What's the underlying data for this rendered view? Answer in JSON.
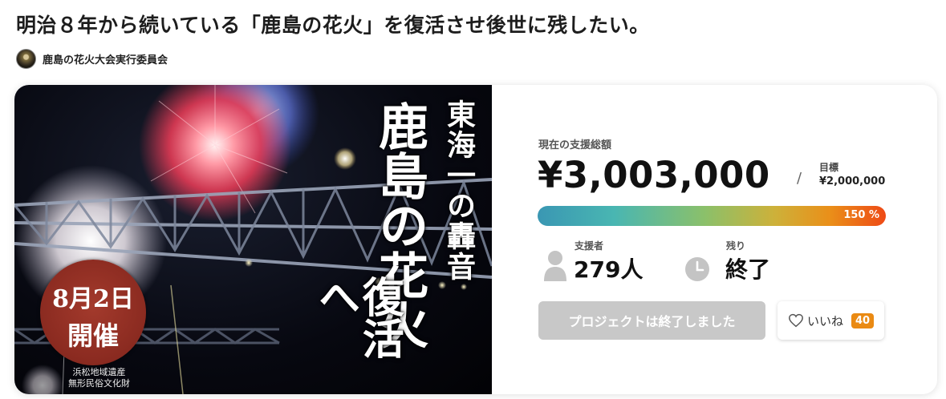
{
  "page": {
    "title": "明治８年から続いている「鹿島の花火」を復活させ後世に残したい。"
  },
  "owner": {
    "name": "鹿島の花火大会実行委員会"
  },
  "hero": {
    "catch_small": "東海一の轟音",
    "catch_big_1": "鹿島の花火",
    "catch_big_2": "復活へ",
    "badge_date": "8月2日",
    "badge_event": "開催",
    "heritage_line1": "浜松地域遺産",
    "heritage_line2": "無形民俗文化財"
  },
  "funding": {
    "current_label": "現在の支援総額",
    "current_amount": "¥3,003,000",
    "separator": "/",
    "goal_label": "目標",
    "goal_amount": "¥2,000,000",
    "percent_label": "150 %",
    "percent": 150,
    "supporters_label": "支援者",
    "supporters_value": "279人",
    "remaining_label": "残り",
    "remaining_value": "終了"
  },
  "actions": {
    "ended_button_label": "プロジェクトは終了しました",
    "like_label": "いいね",
    "like_count": "40"
  },
  "colors": {
    "badge_red": "#8a2a20",
    "like_badge": "#ea8a13",
    "disabled_button": "#c8c8c8"
  },
  "icons": [
    "avatar",
    "person-icon",
    "clock-icon",
    "heart-icon"
  ]
}
